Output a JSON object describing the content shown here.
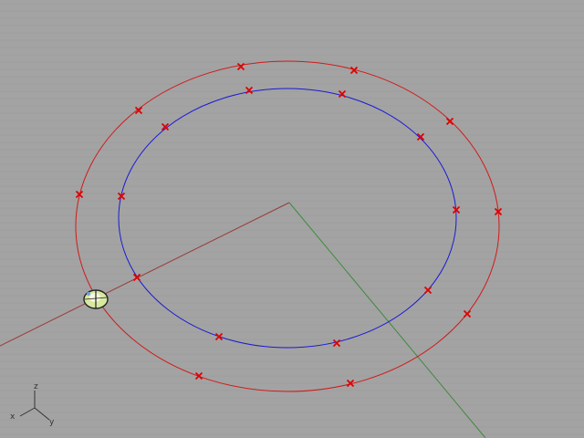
{
  "viewport": {
    "name": "perspective-viewport",
    "background_color": "#a3a3a3",
    "grid_color": "#9a9a9a"
  },
  "world_axes": {
    "x_axis_color": "#9a3a3a",
    "y_axis_color": "#3f8a3f"
  },
  "curves": [
    {
      "name": "outer-circle-curve",
      "color": "#d11a1a",
      "control_point_count": 12
    },
    {
      "name": "inner-circle-curve",
      "color": "#1a1ad6",
      "control_point_count": 12
    }
  ],
  "control_point_marker": {
    "color": "#e00000",
    "icon": "x-mark-icon"
  },
  "gumball": {
    "icon": "gumball-widget-icon"
  },
  "axis_widget": {
    "labels": {
      "x": "x",
      "y": "y",
      "z": "z"
    },
    "color": "#333333"
  }
}
